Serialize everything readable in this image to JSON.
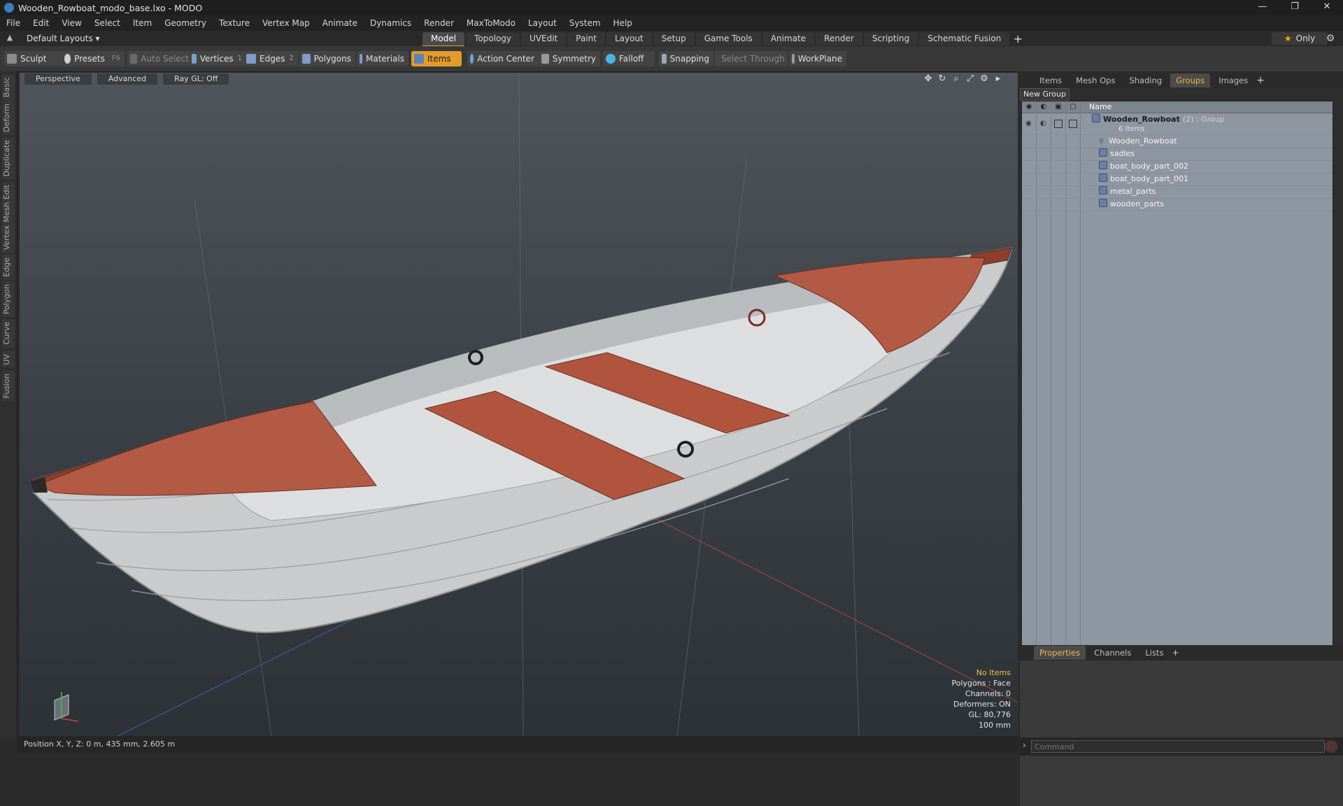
{
  "window": {
    "title": "Wooden_Rowboat_modo_base.lxo - MODO",
    "controls": [
      "—",
      "❐",
      "✕"
    ]
  },
  "menu": [
    "File",
    "Edit",
    "View",
    "Select",
    "Item",
    "Geometry",
    "Texture",
    "Vertex Map",
    "Animate",
    "Dynamics",
    "Render",
    "MaxToModo",
    "Layout",
    "System",
    "Help"
  ],
  "layoutbar": {
    "layout_label": "Default Layouts ▾",
    "tabs": [
      "Model",
      "Topology",
      "UVEdit",
      "Paint",
      "Layout",
      "Setup",
      "Game Tools",
      "Animate",
      "Render",
      "Scripting",
      "Schematic Fusion"
    ],
    "active_tab": "Model",
    "only_label": "Only"
  },
  "toolbar": {
    "sculpt": "Sculpt",
    "presets": "Presets",
    "presets_key": "F6",
    "auto_select": "Auto Select",
    "vertices": "Vertices",
    "vertices_count": "1",
    "edges": "Edges",
    "edges_count": "2",
    "polygons": "Polygons",
    "materials": "Materials",
    "items": "Items",
    "action_center": "Action Center",
    "symmetry": "Symmetry",
    "falloff": "Falloff",
    "snapping": "Snapping",
    "select_through": "Select Through",
    "workplane": "WorkPlane"
  },
  "left_tabs": [
    "Basic",
    "Deform",
    "Duplicate",
    "Mesh Edit",
    "Vertex",
    "Edge",
    "Polygon",
    "Curve",
    "UV",
    "Fusion"
  ],
  "viewport": {
    "perspective": "Perspective",
    "advanced": "Advanced",
    "raygl": "Ray GL: Off",
    "info": {
      "no_items": "No Items",
      "polygons": "Polygons : Face",
      "channels": "Channels: 0",
      "deformers": "Deformers: ON",
      "gl": "GL: 80,776",
      "scale": "100 mm"
    }
  },
  "status": "Position X, Y, Z:  0 m, 435 mm, 2.605 m",
  "right_panel": {
    "tabs": [
      "Items",
      "Mesh Ops",
      "Shading",
      "Groups",
      "Images"
    ],
    "active_tab": "Groups",
    "new_group": "New Group",
    "name_header": "Name",
    "group": {
      "name": "Wooden_Rowboat",
      "count": "(2) : Group",
      "sub": "6 Items"
    },
    "items": [
      "Wooden_Rowboat",
      "sadles",
      "boat_body_part_002",
      "boat_body_part_001",
      "metal_parts",
      "wooden_parts"
    ],
    "bottom_tabs": [
      "Properties",
      "Channels",
      "Lists"
    ],
    "bottom_active": "Properties",
    "command_placeholder": "Command"
  },
  "colors": {
    "accent": "#e39b2a",
    "list_bg": "#8e96a1",
    "viewport_top": "#4f555b",
    "viewport_bottom": "#2d3237"
  }
}
